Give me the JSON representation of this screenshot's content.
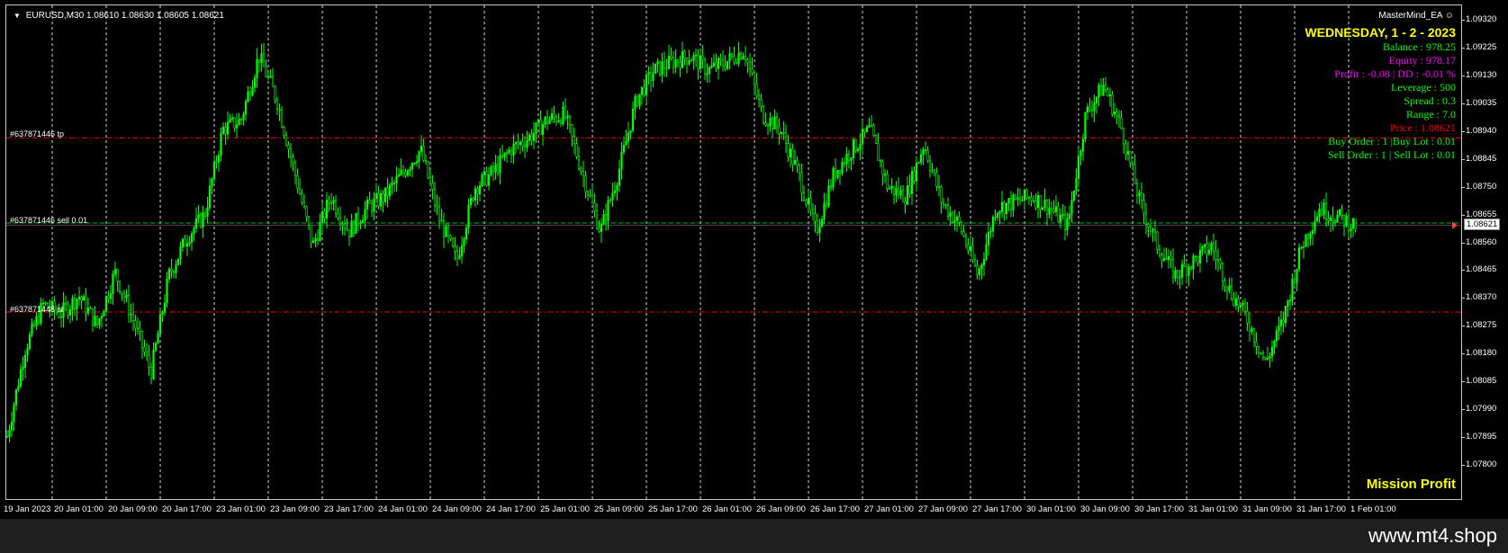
{
  "header": {
    "symbol": "EURUSD,M30",
    "ohlc": "1.08610 1.08630 1.08605 1.08621"
  },
  "ea_name": "MasterMind_EA",
  "info_panel": {
    "date": "WEDNESDAY, 1 - 2 - 2023",
    "balance": "Balance : 978.25",
    "equity": "Equity   : 978.17",
    "profit": "Profit : -0.08 | DD : -0.01 %",
    "leverage": "Leverage : 500",
    "spread": "Spread : 0.3",
    "range": "Range : 7.0",
    "price": "Price : 1.08621",
    "buy_order": "Buy Order : 1 |Buy Lot : 0.01",
    "sell_order": "Sell Order : 1 | Sell Lot : 0.01"
  },
  "mission_text": "Mission Profit",
  "watermark": "www.mt4.shop",
  "orders": {
    "tp_label": "#637871446 tp",
    "sell_label": "#637871446 sell 0.01",
    "sl_label": "#637871448 sl"
  },
  "price_axis": {
    "ticks": [
      "1.09320",
      "1.09225",
      "1.09130",
      "1.09035",
      "1.08940",
      "1.08845",
      "1.08750",
      "1.08655",
      "1.08560",
      "1.08465",
      "1.08370",
      "1.08275",
      "1.08180",
      "1.08085",
      "1.07990",
      "1.07895",
      "1.07800"
    ],
    "current": "1.08621"
  },
  "time_axis": {
    "labels": [
      "19 Jan 2023",
      "20 Jan 01:00",
      "20 Jan 09:00",
      "20 Jan 17:00",
      "23 Jan 01:00",
      "23 Jan 09:00",
      "23 Jan 17:00",
      "24 Jan 01:00",
      "24 Jan 09:00",
      "24 Jan 17:00",
      "25 Jan 01:00",
      "25 Jan 09:00",
      "25 Jan 17:00",
      "26 Jan 01:00",
      "26 Jan 09:00",
      "26 Jan 17:00",
      "27 Jan 01:00",
      "27 Jan 09:00",
      "27 Jan 17:00",
      "30 Jan 01:00",
      "30 Jan 09:00",
      "30 Jan 17:00",
      "31 Jan 01:00",
      "31 Jan 09:00",
      "31 Jan 17:00",
      "1 Feb 01:00"
    ]
  },
  "colors": {
    "background": "#000000",
    "candle": "#00ff00",
    "grid": "#ffffff",
    "order_line": "#ff0000",
    "price_line": "#00c000",
    "panel_green": "#00ff00",
    "panel_magenta": "#ff00ff",
    "panel_red": "#ff0000",
    "panel_yellow": "#ffff00"
  },
  "chart_data": {
    "type": "candlestick",
    "symbol": "EURUSD",
    "timeframe": "M30",
    "ylim": [
      1.078,
      1.0934
    ],
    "order_levels": {
      "tp": 1.0892,
      "entry": 1.08629,
      "sl": 1.08325
    },
    "current_price": 1.08621,
    "series": [
      {
        "x": "19 Jan 2023",
        "value": 1.079
      },
      {
        "x": "19 Jan 2023",
        "value": 1.082
      },
      {
        "x": "19 Jan 2023",
        "value": 1.0835
      },
      {
        "x": "20 Jan 01:00",
        "value": 1.0832
      },
      {
        "x": "20 Jan 01:00",
        "value": 1.0838
      },
      {
        "x": "20 Jan 01:00",
        "value": 1.0828
      },
      {
        "x": "20 Jan 09:00",
        "value": 1.0846
      },
      {
        "x": "20 Jan 09:00",
        "value": 1.083
      },
      {
        "x": "20 Jan 17:00",
        "value": 1.0812
      },
      {
        "x": "20 Jan 17:00",
        "value": 1.0845
      },
      {
        "x": "20 Jan 17:00",
        "value": 1.0858
      },
      {
        "x": "23 Jan 01:00",
        "value": 1.0866
      },
      {
        "x": "23 Jan 01:00",
        "value": 1.0895
      },
      {
        "x": "23 Jan 01:00",
        "value": 1.0898
      },
      {
        "x": "23 Jan 09:00",
        "value": 1.092
      },
      {
        "x": "23 Jan 09:00",
        "value": 1.0905
      },
      {
        "x": "23 Jan 09:00",
        "value": 1.088
      },
      {
        "x": "23 Jan 17:00",
        "value": 1.0855
      },
      {
        "x": "23 Jan 17:00",
        "value": 1.0872
      },
      {
        "x": "23 Jan 17:00",
        "value": 1.086
      },
      {
        "x": "24 Jan 01:00",
        "value": 1.0868
      },
      {
        "x": "24 Jan 01:00",
        "value": 1.0872
      },
      {
        "x": "24 Jan 01:00",
        "value": 1.088
      },
      {
        "x": "24 Jan 09:00",
        "value": 1.0888
      },
      {
        "x": "24 Jan 09:00",
        "value": 1.0865
      },
      {
        "x": "24 Jan 09:00",
        "value": 1.085
      },
      {
        "x": "24 Jan 17:00",
        "value": 1.0875
      },
      {
        "x": "24 Jan 17:00",
        "value": 1.088
      },
      {
        "x": "24 Jan 17:00",
        "value": 1.0888
      },
      {
        "x": "25 Jan 01:00",
        "value": 1.0892
      },
      {
        "x": "25 Jan 01:00",
        "value": 1.0898
      },
      {
        "x": "25 Jan 01:00",
        "value": 1.09
      },
      {
        "x": "25 Jan 09:00",
        "value": 1.088
      },
      {
        "x": "25 Jan 09:00",
        "value": 1.086
      },
      {
        "x": "25 Jan 09:00",
        "value": 1.088
      },
      {
        "x": "25 Jan 17:00",
        "value": 1.0905
      },
      {
        "x": "25 Jan 17:00",
        "value": 1.0915
      },
      {
        "x": "25 Jan 17:00",
        "value": 1.0918
      },
      {
        "x": "26 Jan 01:00",
        "value": 1.092
      },
      {
        "x": "26 Jan 01:00",
        "value": 1.0915
      },
      {
        "x": "26 Jan 01:00",
        "value": 1.0918
      },
      {
        "x": "26 Jan 09:00",
        "value": 1.0922
      },
      {
        "x": "26 Jan 09:00",
        "value": 1.09
      },
      {
        "x": "26 Jan 09:00",
        "value": 1.0895
      },
      {
        "x": "26 Jan 17:00",
        "value": 1.088
      },
      {
        "x": "26 Jan 17:00",
        "value": 1.086
      },
      {
        "x": "26 Jan 17:00",
        "value": 1.088
      },
      {
        "x": "27 Jan 01:00",
        "value": 1.0888
      },
      {
        "x": "27 Jan 01:00",
        "value": 1.0895
      },
      {
        "x": "27 Jan 01:00",
        "value": 1.0875
      },
      {
        "x": "27 Jan 09:00",
        "value": 1.0872
      },
      {
        "x": "27 Jan 09:00",
        "value": 1.089
      },
      {
        "x": "27 Jan 09:00",
        "value": 1.087
      },
      {
        "x": "27 Jan 17:00",
        "value": 1.0862
      },
      {
        "x": "27 Jan 17:00",
        "value": 1.0845
      },
      {
        "x": "27 Jan 17:00",
        "value": 1.0868
      },
      {
        "x": "30 Jan 01:00",
        "value": 1.087
      },
      {
        "x": "30 Jan 01:00",
        "value": 1.0872
      },
      {
        "x": "30 Jan 01:00",
        "value": 1.0868
      },
      {
        "x": "30 Jan 09:00",
        "value": 1.0862
      },
      {
        "x": "30 Jan 09:00",
        "value": 1.09
      },
      {
        "x": "30 Jan 09:00",
        "value": 1.091
      },
      {
        "x": "30 Jan 17:00",
        "value": 1.0895
      },
      {
        "x": "30 Jan 17:00",
        "value": 1.087
      },
      {
        "x": "30 Jan 17:00",
        "value": 1.0855
      },
      {
        "x": "31 Jan 01:00",
        "value": 1.0845
      },
      {
        "x": "31 Jan 01:00",
        "value": 1.085
      },
      {
        "x": "31 Jan 01:00",
        "value": 1.0855
      },
      {
        "x": "31 Jan 09:00",
        "value": 1.084
      },
      {
        "x": "31 Jan 09:00",
        "value": 1.083
      },
      {
        "x": "31 Jan 09:00",
        "value": 1.0815
      },
      {
        "x": "31 Jan 17:00",
        "value": 1.083
      },
      {
        "x": "31 Jan 17:00",
        "value": 1.0855
      },
      {
        "x": "31 Jan 17:00",
        "value": 1.0868
      },
      {
        "x": "1 Feb 01:00",
        "value": 1.0865
      },
      {
        "x": "1 Feb 01:00",
        "value": 1.08621
      }
    ]
  }
}
